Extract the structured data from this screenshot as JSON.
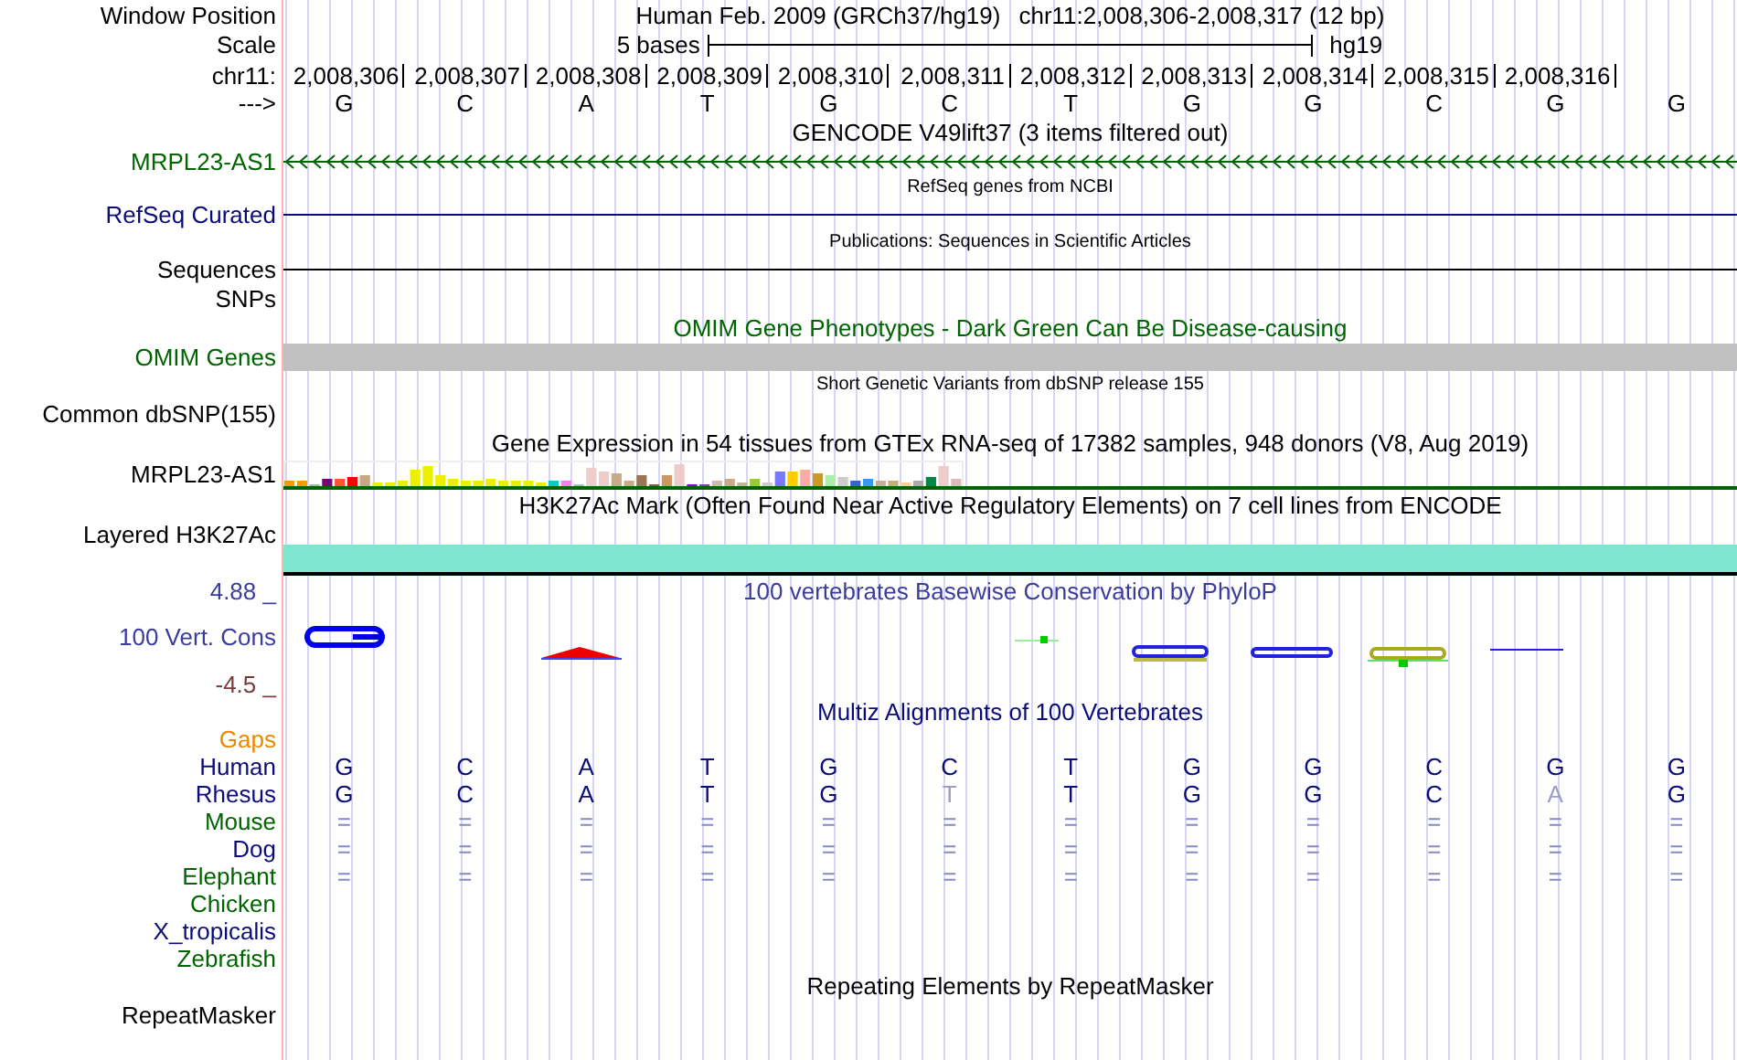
{
  "header": {
    "label": "Window Position",
    "assembly": "Human Feb. 2009 (GRCh37/hg19)",
    "position": "chr11:2,008,306-2,008,317 (12 bp)"
  },
  "scale": {
    "label": "Scale",
    "length": "5 bases",
    "assembly": "hg19"
  },
  "ruler": {
    "label": "chr11:",
    "positions": [
      "2,008,306",
      "2,008,307",
      "2,008,308",
      "2,008,309",
      "2,008,310",
      "2,008,311",
      "2,008,312",
      "2,008,313",
      "2,008,314",
      "2,008,315",
      "2,008,316"
    ]
  },
  "sequence": {
    "label": "--->",
    "bases": [
      "G",
      "C",
      "A",
      "T",
      "G",
      "C",
      "T",
      "G",
      "G",
      "C",
      "G",
      "G"
    ]
  },
  "tracks": [
    {
      "kind": "gene",
      "title": "GENCODE V49lift37 (3 items filtered out)",
      "labels": [
        "MRPL23-AS1"
      ]
    },
    {
      "kind": "line",
      "title": "RefSeq genes from NCBI",
      "labels": [
        "RefSeq Curated"
      ]
    },
    {
      "kind": "publications",
      "title": "Publications: Sequences in Scientific Articles",
      "labels": [
        "Sequences",
        "SNPs"
      ]
    },
    {
      "kind": "omim",
      "title": "OMIM Gene Phenotypes - Dark Green Can Be Disease-causing",
      "labels": [
        "OMIM Genes"
      ]
    },
    {
      "kind": "snp",
      "title": "Short Genetic Variants from dbSNP release 155",
      "labels": [
        "Common dbSNP(155)"
      ]
    },
    {
      "kind": "expression",
      "title": "Gene Expression in 54 tissues from GTEx RNA-seq of 17382 samples, 948 donors (V8, Aug 2019)",
      "labels": [
        "MRPL23-AS1"
      ]
    },
    {
      "kind": "signal",
      "title": "H3K27Ac Mark (Often Found Near Active Regulatory Elements) on 7 cell lines from ENCODE",
      "labels": [
        "Layered H3K27Ac"
      ]
    },
    {
      "kind": "conservation",
      "title": "100 vertebrates Basewise Conservation by PhyloP",
      "labels": [
        "100 Vert. Cons"
      ],
      "max": "4.88 _",
      "min": "-4.5 _"
    },
    {
      "kind": "alignment",
      "title": "Multiz Alignments of 100 Vertebrates",
      "labels": [
        "Gaps"
      ],
      "species": [
        {
          "name": "Human",
          "color": "#0c0c78",
          "kind": "sequence",
          "bases": [
            "G",
            "C",
            "A",
            "T",
            "G",
            "C",
            "T",
            "G",
            "G",
            "C",
            "G",
            "G"
          ],
          "differs": [
            false,
            false,
            false,
            false,
            false,
            false,
            false,
            false,
            false,
            false,
            false,
            false
          ]
        },
        {
          "name": "Rhesus",
          "color": "#0c0c78",
          "kind": "sequence",
          "bases": [
            "G",
            "C",
            "A",
            "T",
            "G",
            "T",
            "T",
            "G",
            "G",
            "C",
            "A",
            "G"
          ],
          "differs": [
            false,
            false,
            false,
            false,
            false,
            true,
            false,
            false,
            false,
            false,
            true,
            false
          ]
        },
        {
          "name": "Mouse",
          "color": "#006400",
          "kind": "matches",
          "bases": [
            "=",
            "=",
            "=",
            "=",
            "=",
            "=",
            "=",
            "=",
            "=",
            "=",
            "=",
            "="
          ]
        },
        {
          "name": "Dog",
          "color": "#0c0c78",
          "kind": "matches",
          "bases": [
            "=",
            "=",
            "=",
            "=",
            "=",
            "=",
            "=",
            "=",
            "=",
            "=",
            "=",
            "="
          ]
        },
        {
          "name": "Elephant",
          "color": "#006400",
          "kind": "matches",
          "bases": [
            "=",
            "=",
            "=",
            "=",
            "=",
            "=",
            "=",
            "=",
            "=",
            "=",
            "=",
            "="
          ]
        },
        {
          "name": "Chicken",
          "color": "#006400",
          "kind": "none"
        },
        {
          "name": "X_tropicalis",
          "color": "#0c0c78",
          "kind": "none"
        },
        {
          "name": "Zebrafish",
          "color": "#006400",
          "kind": "none"
        }
      ]
    },
    {
      "kind": "repeats",
      "title": "Repeating Elements by RepeatMasker",
      "labels": [
        "RepeatMasker"
      ]
    }
  ]
}
